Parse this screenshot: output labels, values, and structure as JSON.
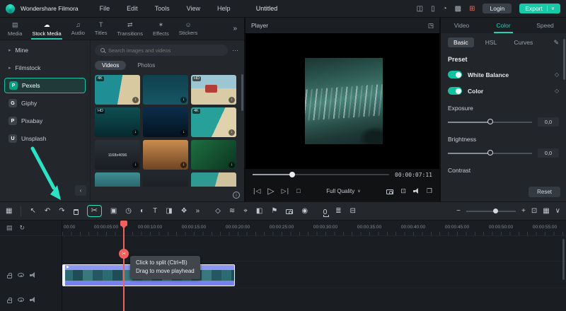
{
  "app": {
    "name": "Wondershare Filmora",
    "menus": [
      "File",
      "Edit",
      "Tools",
      "View",
      "Help"
    ],
    "project_title": "Untitled",
    "login_label": "Login",
    "export_label": "Export",
    "export_chevron": "∨"
  },
  "topbar_icons": [
    {
      "name": "workspace-icon",
      "glyph": "◫"
    },
    {
      "name": "mobile-export-icon",
      "glyph": "▯"
    },
    {
      "name": "notifications-icon",
      "glyph": "◔"
    },
    {
      "name": "gift-icon",
      "glyph": "▩"
    },
    {
      "name": "cart-icon",
      "glyph": "⊞"
    }
  ],
  "media_tabs": {
    "items": [
      {
        "label": "Media",
        "glyph": "▤"
      },
      {
        "label": "Stock Media",
        "glyph": "☁"
      },
      {
        "label": "Audio",
        "glyph": "♫"
      },
      {
        "label": "Titles",
        "glyph": "T"
      },
      {
        "label": "Transitions",
        "glyph": "⇄"
      },
      {
        "label": "Effects",
        "glyph": "✶"
      },
      {
        "label": "Stickers",
        "glyph": "☺"
      }
    ],
    "more_glyph": "»"
  },
  "stock_sources": {
    "chevron_glyph": "▸",
    "items": [
      {
        "label": "Mine"
      },
      {
        "label": "Filmstock"
      },
      {
        "label": "Pexels",
        "abbr": "P"
      },
      {
        "label": "Giphy",
        "abbr": "G"
      },
      {
        "label": "Pixabay",
        "abbr": "P"
      },
      {
        "label": "Unsplash",
        "abbr": "U"
      }
    ]
  },
  "search": {
    "placeholder": "Search images and videos",
    "more_glyph": "⋯"
  },
  "filter_tabs": {
    "videos": "Videos",
    "photos": "Photos"
  },
  "misc": {
    "info_glyph": "i",
    "collapse_glyph": "‹"
  },
  "grid": {
    "download_glyph": "↓",
    "items": [
      {
        "badge": "4K",
        "caption": ""
      },
      {
        "badge": "",
        "caption": ""
      },
      {
        "badge": "HD",
        "caption": ""
      },
      {
        "badge": "HD",
        "caption": ""
      },
      {
        "badge": "",
        "caption": ""
      },
      {
        "badge": "4K",
        "caption": ""
      },
      {
        "badge": "",
        "caption": "1168x4096"
      },
      {
        "badge": "",
        "caption": ""
      },
      {
        "badge": "",
        "caption": ""
      },
      {
        "badge": "",
        "caption": ""
      },
      {
        "badge": "",
        "caption": ""
      },
      {
        "badge": "",
        "caption": ""
      }
    ]
  },
  "player": {
    "title": "Player",
    "display_icon_glyph": "◳",
    "timecode": "00:00:07:11",
    "quality_label": "Full Quality",
    "controls": {
      "prev": "∣◁",
      "play": "▷",
      "next": "▷∣",
      "stop": "□",
      "chevron": "∨",
      "fit": "⊡",
      "fullscreen": "❐"
    }
  },
  "adjust": {
    "tabs": [
      "Video",
      "Color",
      "Speed"
    ],
    "subtabs": [
      "Basic",
      "HSL",
      "Curves"
    ],
    "save_preset_glyph": "✎",
    "preset_label": "Preset",
    "white_balance_label": "White Balance",
    "color_label": "Color",
    "keyframe_glyph": "◇",
    "exposure_label": "Exposure",
    "exposure_value": "0,0",
    "brightness_label": "Brightness",
    "brightness_value": "0,0",
    "contrast_label": "Contrast",
    "reset_label": "Reset"
  },
  "toolbar": {
    "left": [
      {
        "name": "storyboard-icon",
        "glyph": "▦"
      },
      {
        "name": "pointer-tool-icon",
        "glyph": "↖"
      },
      {
        "name": "undo-icon",
        "glyph": "↶"
      },
      {
        "name": "redo-icon",
        "glyph": "↷"
      },
      {
        "name": "split-icon",
        "glyph": "✂"
      },
      {
        "name": "crop-icon",
        "glyph": "▣"
      },
      {
        "name": "speed-icon",
        "glyph": "◷"
      },
      {
        "name": "color-correction-icon",
        "glyph": "◐"
      },
      {
        "name": "text-icon",
        "glyph": "T"
      },
      {
        "name": "pip-icon",
        "glyph": "◨"
      },
      {
        "name": "effects-icon",
        "glyph": "❖"
      },
      {
        "name": "more-tools-icon",
        "glyph": "»"
      }
    ],
    "mid": [
      {
        "name": "keyframe-icon",
        "glyph": "◇"
      },
      {
        "name": "speed-ramp-icon",
        "glyph": "≋"
      },
      {
        "name": "motion-tracking-icon",
        "glyph": "⌖"
      },
      {
        "name": "chroma-key-icon",
        "glyph": "◧"
      },
      {
        "name": "marker-icon",
        "glyph": "⚑"
      },
      {
        "name": "record-icon",
        "glyph": "◉"
      }
    ],
    "right": [
      {
        "name": "audio-mixer-icon",
        "glyph": "≣"
      },
      {
        "name": "auto-ripple-icon",
        "glyph": "⊟"
      }
    ],
    "zoom": {
      "out": "−",
      "in": "+",
      "fit": "⊡",
      "view": "▦",
      "chevron": "∨"
    }
  },
  "timeline": {
    "top_icons": [
      {
        "name": "manage-tracks-icon",
        "glyph": "▤"
      },
      {
        "name": "refresh-icon",
        "glyph": "↻"
      }
    ],
    "ruler_labels": [
      "00:00",
      "00:00:05:00",
      "00:00:10:00",
      "00:00:15:00",
      "00:00:20:00",
      "00:00:25:00",
      "00:00:30:00",
      "00:00:35:00",
      "00:00:40:00",
      "00:00:45:00",
      "00:00:50:00",
      "00:00:55:00"
    ],
    "clip_play_glyph": "▶",
    "split_handle_glyph": "✂",
    "tooltip_line1": "Click to split (Ctrl+B)",
    "tooltip_line2": "Drag to move playhead"
  },
  "colors": {
    "accent": "#1ed0b0",
    "annotation_arrow": "#2ae3c5",
    "clip": "#8187ef",
    "playhead": "#f2605e",
    "pexels_brand": "#05a081"
  }
}
